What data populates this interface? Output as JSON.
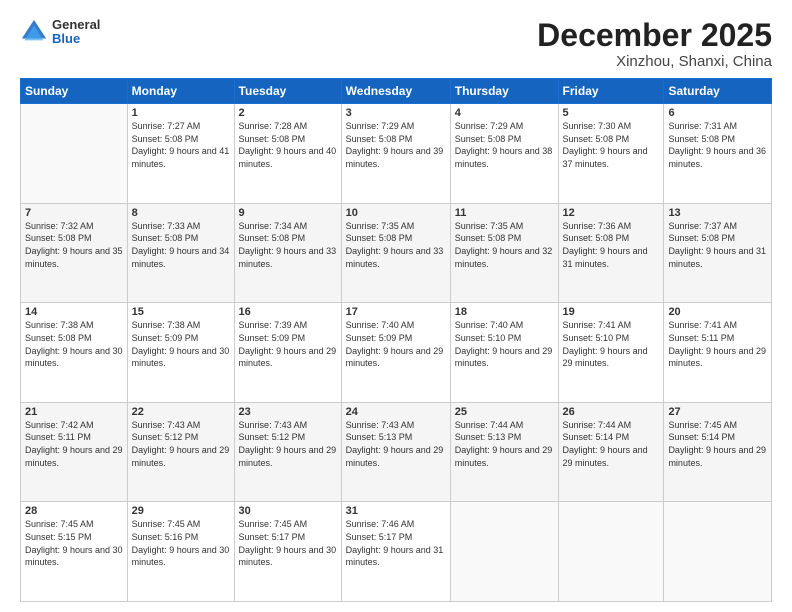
{
  "header": {
    "logo_general": "General",
    "logo_blue": "Blue",
    "month_title": "December 2025",
    "location": "Xinzhou, Shanxi, China"
  },
  "calendar": {
    "days_of_week": [
      "Sunday",
      "Monday",
      "Tuesday",
      "Wednesday",
      "Thursday",
      "Friday",
      "Saturday"
    ],
    "weeks": [
      [
        {
          "day": "",
          "sunrise": "",
          "sunset": "",
          "daylight": ""
        },
        {
          "day": "1",
          "sunrise": "Sunrise: 7:27 AM",
          "sunset": "Sunset: 5:08 PM",
          "daylight": "Daylight: 9 hours and 41 minutes."
        },
        {
          "day": "2",
          "sunrise": "Sunrise: 7:28 AM",
          "sunset": "Sunset: 5:08 PM",
          "daylight": "Daylight: 9 hours and 40 minutes."
        },
        {
          "day": "3",
          "sunrise": "Sunrise: 7:29 AM",
          "sunset": "Sunset: 5:08 PM",
          "daylight": "Daylight: 9 hours and 39 minutes."
        },
        {
          "day": "4",
          "sunrise": "Sunrise: 7:29 AM",
          "sunset": "Sunset: 5:08 PM",
          "daylight": "Daylight: 9 hours and 38 minutes."
        },
        {
          "day": "5",
          "sunrise": "Sunrise: 7:30 AM",
          "sunset": "Sunset: 5:08 PM",
          "daylight": "Daylight: 9 hours and 37 minutes."
        },
        {
          "day": "6",
          "sunrise": "Sunrise: 7:31 AM",
          "sunset": "Sunset: 5:08 PM",
          "daylight": "Daylight: 9 hours and 36 minutes."
        }
      ],
      [
        {
          "day": "7",
          "sunrise": "Sunrise: 7:32 AM",
          "sunset": "Sunset: 5:08 PM",
          "daylight": "Daylight: 9 hours and 35 minutes."
        },
        {
          "day": "8",
          "sunrise": "Sunrise: 7:33 AM",
          "sunset": "Sunset: 5:08 PM",
          "daylight": "Daylight: 9 hours and 34 minutes."
        },
        {
          "day": "9",
          "sunrise": "Sunrise: 7:34 AM",
          "sunset": "Sunset: 5:08 PM",
          "daylight": "Daylight: 9 hours and 33 minutes."
        },
        {
          "day": "10",
          "sunrise": "Sunrise: 7:35 AM",
          "sunset": "Sunset: 5:08 PM",
          "daylight": "Daylight: 9 hours and 33 minutes."
        },
        {
          "day": "11",
          "sunrise": "Sunrise: 7:35 AM",
          "sunset": "Sunset: 5:08 PM",
          "daylight": "Daylight: 9 hours and 32 minutes."
        },
        {
          "day": "12",
          "sunrise": "Sunrise: 7:36 AM",
          "sunset": "Sunset: 5:08 PM",
          "daylight": "Daylight: 9 hours and 31 minutes."
        },
        {
          "day": "13",
          "sunrise": "Sunrise: 7:37 AM",
          "sunset": "Sunset: 5:08 PM",
          "daylight": "Daylight: 9 hours and 31 minutes."
        }
      ],
      [
        {
          "day": "14",
          "sunrise": "Sunrise: 7:38 AM",
          "sunset": "Sunset: 5:08 PM",
          "daylight": "Daylight: 9 hours and 30 minutes."
        },
        {
          "day": "15",
          "sunrise": "Sunrise: 7:38 AM",
          "sunset": "Sunset: 5:09 PM",
          "daylight": "Daylight: 9 hours and 30 minutes."
        },
        {
          "day": "16",
          "sunrise": "Sunrise: 7:39 AM",
          "sunset": "Sunset: 5:09 PM",
          "daylight": "Daylight: 9 hours and 29 minutes."
        },
        {
          "day": "17",
          "sunrise": "Sunrise: 7:40 AM",
          "sunset": "Sunset: 5:09 PM",
          "daylight": "Daylight: 9 hours and 29 minutes."
        },
        {
          "day": "18",
          "sunrise": "Sunrise: 7:40 AM",
          "sunset": "Sunset: 5:10 PM",
          "daylight": "Daylight: 9 hours and 29 minutes."
        },
        {
          "day": "19",
          "sunrise": "Sunrise: 7:41 AM",
          "sunset": "Sunset: 5:10 PM",
          "daylight": "Daylight: 9 hours and 29 minutes."
        },
        {
          "day": "20",
          "sunrise": "Sunrise: 7:41 AM",
          "sunset": "Sunset: 5:11 PM",
          "daylight": "Daylight: 9 hours and 29 minutes."
        }
      ],
      [
        {
          "day": "21",
          "sunrise": "Sunrise: 7:42 AM",
          "sunset": "Sunset: 5:11 PM",
          "daylight": "Daylight: 9 hours and 29 minutes."
        },
        {
          "day": "22",
          "sunrise": "Sunrise: 7:43 AM",
          "sunset": "Sunset: 5:12 PM",
          "daylight": "Daylight: 9 hours and 29 minutes."
        },
        {
          "day": "23",
          "sunrise": "Sunrise: 7:43 AM",
          "sunset": "Sunset: 5:12 PM",
          "daylight": "Daylight: 9 hours and 29 minutes."
        },
        {
          "day": "24",
          "sunrise": "Sunrise: 7:43 AM",
          "sunset": "Sunset: 5:13 PM",
          "daylight": "Daylight: 9 hours and 29 minutes."
        },
        {
          "day": "25",
          "sunrise": "Sunrise: 7:44 AM",
          "sunset": "Sunset: 5:13 PM",
          "daylight": "Daylight: 9 hours and 29 minutes."
        },
        {
          "day": "26",
          "sunrise": "Sunrise: 7:44 AM",
          "sunset": "Sunset: 5:14 PM",
          "daylight": "Daylight: 9 hours and 29 minutes."
        },
        {
          "day": "27",
          "sunrise": "Sunrise: 7:45 AM",
          "sunset": "Sunset: 5:14 PM",
          "daylight": "Daylight: 9 hours and 29 minutes."
        }
      ],
      [
        {
          "day": "28",
          "sunrise": "Sunrise: 7:45 AM",
          "sunset": "Sunset: 5:15 PM",
          "daylight": "Daylight: 9 hours and 30 minutes."
        },
        {
          "day": "29",
          "sunrise": "Sunrise: 7:45 AM",
          "sunset": "Sunset: 5:16 PM",
          "daylight": "Daylight: 9 hours and 30 minutes."
        },
        {
          "day": "30",
          "sunrise": "Sunrise: 7:45 AM",
          "sunset": "Sunset: 5:17 PM",
          "daylight": "Daylight: 9 hours and 30 minutes."
        },
        {
          "day": "31",
          "sunrise": "Sunrise: 7:46 AM",
          "sunset": "Sunset: 5:17 PM",
          "daylight": "Daylight: 9 hours and 31 minutes."
        },
        {
          "day": "",
          "sunrise": "",
          "sunset": "",
          "daylight": ""
        },
        {
          "day": "",
          "sunrise": "",
          "sunset": "",
          "daylight": ""
        },
        {
          "day": "",
          "sunrise": "",
          "sunset": "",
          "daylight": ""
        }
      ]
    ]
  }
}
